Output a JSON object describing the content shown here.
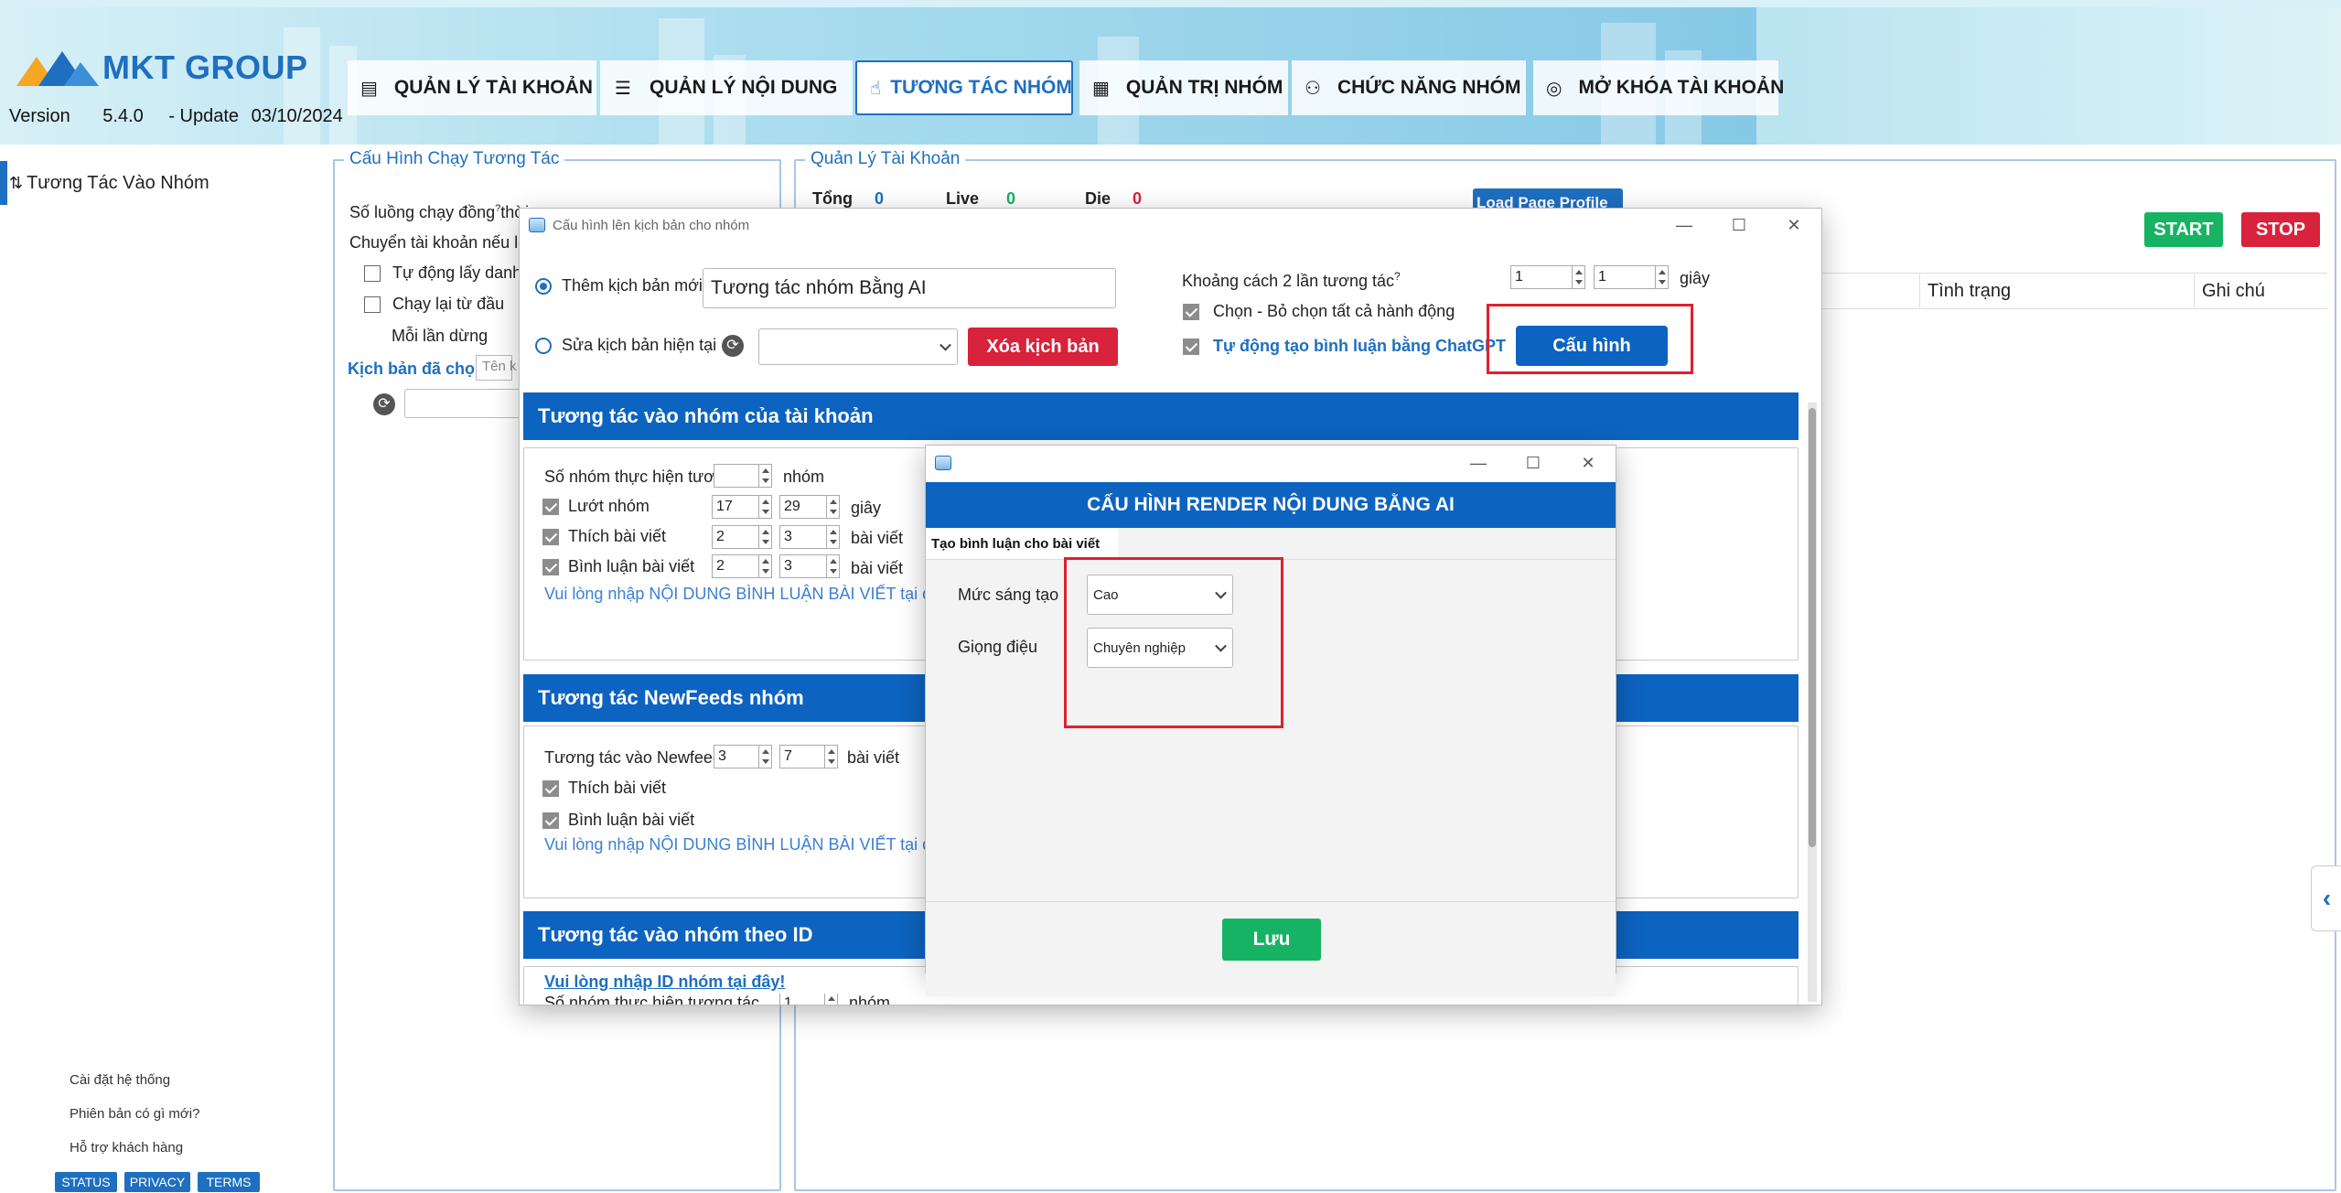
{
  "app": {
    "logo": "MKT GROUP",
    "version_label": "Version",
    "version": "5.4.0",
    "update_label": "- Update",
    "update_date": "03/10/2024"
  },
  "nav": {
    "tabs": [
      {
        "label": "QUẢN LÝ TÀI KHOẢN",
        "icon": "account-list-icon"
      },
      {
        "label": "QUẢN LÝ NỘI DUNG",
        "icon": "content-list-icon"
      },
      {
        "label": "TƯƠNG TÁC NHÓM",
        "icon": "hand-pointer-icon",
        "active": true
      },
      {
        "label": "QUẢN TRỊ NHÓM",
        "icon": "admin-doc-icon"
      },
      {
        "label": "CHỨC NĂNG NHÓM",
        "icon": "group-people-icon"
      },
      {
        "label": "MỞ KHÓA TÀI KHOẢN",
        "icon": "fingerprint-icon"
      }
    ]
  },
  "sidebar": {
    "items": [
      {
        "label": "Tương Tác Vào Nhóm",
        "icon": "sort-arrows-icon"
      }
    ],
    "footer_links": [
      "Cài đặt hệ thống",
      "Phiên bản có gì mới?",
      "Hỗ trợ khách hàng"
    ],
    "footer_buttons": [
      "STATUS",
      "PRIVACY",
      "TERMS"
    ]
  },
  "config_panel": {
    "title": "Cấu Hình Chạy Tương Tác",
    "threads_label": "Số luồng chạy đồng",
    "threads_suffix": "thời",
    "switch_label": "Chuyển tài khoản nếu lỗ",
    "auto_name_label": "Tự động lấy danh",
    "restart_label": "Chạy lại từ đầu",
    "each_stop_label": "Mỗi lần dừng",
    "scripts_label": "Kịch bản đã chọ",
    "name_placeholder": "Tên k"
  },
  "account_panel": {
    "title": "Quản Lý Tài Khoản",
    "total_label": "Tổng",
    "total": "0",
    "live_label": "Live",
    "live": "0",
    "die_label": "Die",
    "die": "0",
    "load_profile": "Load Page Profile",
    "start": "START",
    "stop": "STOP",
    "columns": [
      "Tình trạng",
      "Ghi chú"
    ]
  },
  "script_window": {
    "title": "Cấu hình lên kịch bản cho nhóm",
    "new_script_label": "Thêm kịch bản mới",
    "new_script_value": "Tương tác nhóm Bằng AI",
    "edit_script_label": "Sửa kịch bản hiện tại",
    "delete_button": "Xóa kịch bản",
    "interval_label": "Khoảng cách 2 lần tương tác",
    "interval_from": "1",
    "interval_to": "1",
    "interval_unit": "giây",
    "select_all_label": "Chọn - Bỏ chọn tất cả hành động",
    "chatgpt_label": "Tự động tạo bình luận bằng ChatGPT",
    "config_button": "Cấu hình",
    "sections": {
      "s1": {
        "title": "Tương tác vào nhóm của tài khoản",
        "groups_label": "Số nhóm thực hiện tương tác",
        "groups_unit": "nhóm",
        "scroll_label": "Lướt nhóm",
        "scroll_from": "17",
        "scroll_to": "29",
        "scroll_unit": "giây",
        "like_label": "Thích bài viết",
        "like_from": "2",
        "like_to": "3",
        "like_unit": "bài viết",
        "comment_label": "Bình luận bài viết",
        "comment_from": "2",
        "comment_to": "3",
        "comment_unit": "bài viết",
        "link": "Vui lòng nhập NỘI DUNG BÌNH LUẬN BÀI VIẾT tại đây"
      },
      "s2": {
        "title": "Tương tác NewFeeds nhóm",
        "newfeed_label": "Tương tác vào Newfeed",
        "newfeed_from": "3",
        "newfeed_to": "7",
        "newfeed_unit": "bài viết",
        "like_label": "Thích bài viết",
        "comment_label": "Bình luận bài viết",
        "link": "Vui lòng nhập NỘI DUNG BÌNH LUẬN BÀI VIẾT tại đây"
      },
      "s3": {
        "title": "Tương tác vào nhóm theo ID",
        "link": "Vui lòng nhập ID nhóm tại đây!",
        "groups_label": "Số nhóm thực hiện tương tác",
        "groups_value": "1",
        "groups_unit": "nhóm"
      }
    }
  },
  "ai_window": {
    "header": "CẤU HÌNH RENDER NỘI DUNG BẰNG AI",
    "tab": "Tạo bình luận cho bài viết",
    "creativity_label": "Mức sáng tạo",
    "creativity_value": "Cao",
    "tone_label": "Giọng điệu",
    "tone_value": "Chuyên nghiệp",
    "save_button": "Lưu"
  },
  "colors": {
    "brand_blue": "#1e6fc0",
    "section_blue": "#0d63c0",
    "start_green": "#17b364",
    "stop_red": "#d9223b",
    "highlight_red": "#e0202e"
  }
}
